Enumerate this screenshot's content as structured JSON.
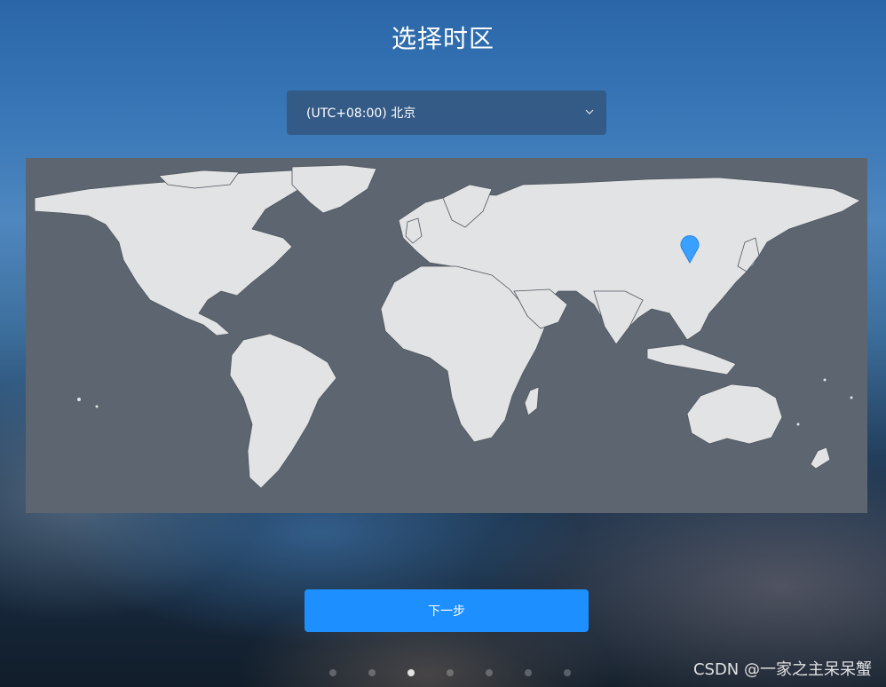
{
  "page": {
    "title": "选择时区"
  },
  "timezone_select": {
    "value": "(UTC+08:00) 北京",
    "icon": "chevron-down-icon"
  },
  "map": {
    "marker_icon": "location-pin-icon",
    "marker_city": "北京",
    "marker_color": "#3aa0ff"
  },
  "actions": {
    "next_label": "下一步",
    "accent": "#1e8fff"
  },
  "pagination": {
    "count": 7,
    "active_index": 2
  },
  "watermark": "CSDN @一家之主呆呆蟹"
}
